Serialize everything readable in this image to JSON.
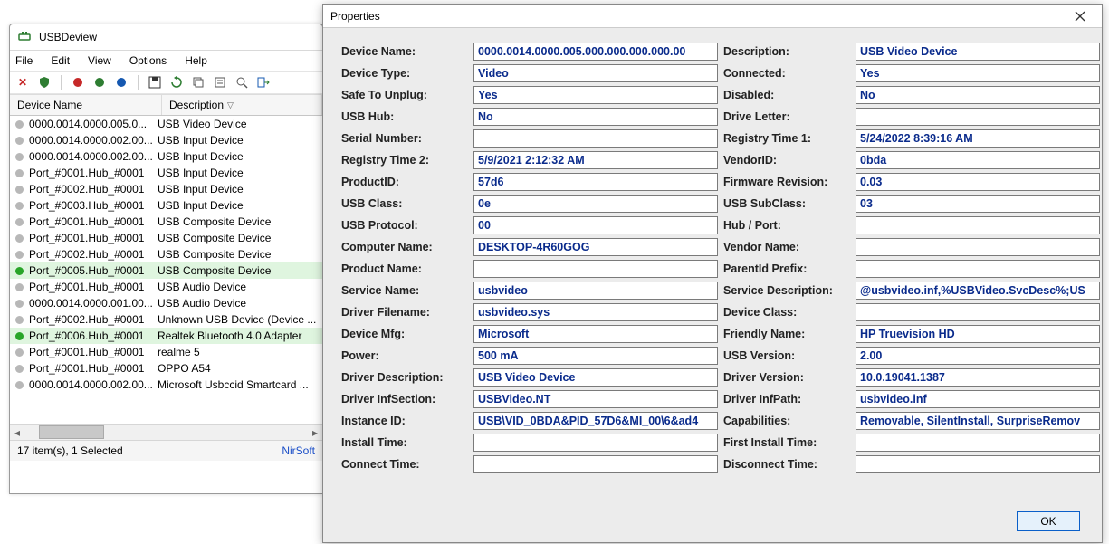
{
  "main": {
    "title": "USBDeview",
    "menu": {
      "file": "File",
      "edit": "Edit",
      "view": "View",
      "options": "Options",
      "help": "Help"
    },
    "columns": {
      "name": "Device Name",
      "desc": "Description"
    },
    "status_left": "17 item(s), 1 Selected",
    "status_right": "NirSoft",
    "rows": [
      {
        "dot": "gray",
        "name": "0000.0014.0000.005.0...",
        "desc": "USB Video Device",
        "hl": false
      },
      {
        "dot": "gray",
        "name": "0000.0014.0000.002.00...",
        "desc": "USB Input Device",
        "hl": false
      },
      {
        "dot": "gray",
        "name": "0000.0014.0000.002.00...",
        "desc": "USB Input Device",
        "hl": false
      },
      {
        "dot": "gray",
        "name": "Port_#0001.Hub_#0001",
        "desc": "USB Input Device",
        "hl": false
      },
      {
        "dot": "gray",
        "name": "Port_#0002.Hub_#0001",
        "desc": "USB Input Device",
        "hl": false
      },
      {
        "dot": "gray",
        "name": "Port_#0003.Hub_#0001",
        "desc": "USB Input Device",
        "hl": false
      },
      {
        "dot": "gray",
        "name": "Port_#0001.Hub_#0001",
        "desc": "USB Composite Device",
        "hl": false
      },
      {
        "dot": "gray",
        "name": "Port_#0001.Hub_#0001",
        "desc": "USB Composite Device",
        "hl": false
      },
      {
        "dot": "gray",
        "name": "Port_#0002.Hub_#0001",
        "desc": "USB Composite Device",
        "hl": false
      },
      {
        "dot": "green",
        "name": "Port_#0005.Hub_#0001",
        "desc": "USB Composite Device",
        "hl": true
      },
      {
        "dot": "gray",
        "name": "Port_#0001.Hub_#0001",
        "desc": "USB Audio Device",
        "hl": false
      },
      {
        "dot": "gray",
        "name": "0000.0014.0000.001.00...",
        "desc": "USB Audio Device",
        "hl": false
      },
      {
        "dot": "gray",
        "name": "Port_#0002.Hub_#0001",
        "desc": "Unknown USB Device (Device ...",
        "hl": false
      },
      {
        "dot": "green",
        "name": "Port_#0006.Hub_#0001",
        "desc": "Realtek Bluetooth 4.0 Adapter",
        "hl": true
      },
      {
        "dot": "gray",
        "name": "Port_#0001.Hub_#0001",
        "desc": "realme 5",
        "hl": false
      },
      {
        "dot": "gray",
        "name": "Port_#0001.Hub_#0001",
        "desc": "OPPO A54",
        "hl": false
      },
      {
        "dot": "gray",
        "name": "0000.0014.0000.002.00...",
        "desc": "Microsoft Usbccid Smartcard ...",
        "hl": false
      }
    ]
  },
  "dlg": {
    "title": "Properties",
    "ok": "OK",
    "fields": {
      "device_name": {
        "l": "Device Name:",
        "v": "0000.0014.0000.005.000.000.000.000.00"
      },
      "description": {
        "l": "Description:",
        "v": "USB Video Device"
      },
      "device_type": {
        "l": "Device Type:",
        "v": "Video"
      },
      "connected": {
        "l": "Connected:",
        "v": "Yes"
      },
      "safe_to_unplug": {
        "l": "Safe To Unplug:",
        "v": "Yes"
      },
      "disabled": {
        "l": "Disabled:",
        "v": "No"
      },
      "usb_hub": {
        "l": "USB Hub:",
        "v": "No"
      },
      "drive_letter": {
        "l": "Drive Letter:",
        "v": ""
      },
      "serial_number": {
        "l": "Serial Number:",
        "v": ""
      },
      "registry_time_1": {
        "l": "Registry Time 1:",
        "v": "5/24/2022 8:39:16 AM"
      },
      "registry_time_2": {
        "l": "Registry Time 2:",
        "v": "5/9/2021 2:12:32 AM"
      },
      "vendor_id": {
        "l": "VendorID:",
        "v": "0bda"
      },
      "product_id": {
        "l": "ProductID:",
        "v": "57d6"
      },
      "firmware_revision": {
        "l": "Firmware Revision:",
        "v": "0.03"
      },
      "usb_class": {
        "l": "USB Class:",
        "v": "0e"
      },
      "usb_subclass": {
        "l": "USB SubClass:",
        "v": "03"
      },
      "usb_protocol": {
        "l": "USB Protocol:",
        "v": "00"
      },
      "hub_port": {
        "l": "Hub / Port:",
        "v": ""
      },
      "computer_name": {
        "l": "Computer Name:",
        "v": "DESKTOP-4R60GOG"
      },
      "vendor_name": {
        "l": "Vendor Name:",
        "v": ""
      },
      "product_name": {
        "l": "Product Name:",
        "v": ""
      },
      "parentid_prefix": {
        "l": "ParentId Prefix:",
        "v": ""
      },
      "service_name": {
        "l": "Service Name:",
        "v": "usbvideo"
      },
      "service_description": {
        "l": "Service Description:",
        "v": "@usbvideo.inf,%USBVideo.SvcDesc%;US"
      },
      "driver_filename": {
        "l": "Driver Filename:",
        "v": "usbvideo.sys"
      },
      "device_class": {
        "l": "Device Class:",
        "v": ""
      },
      "device_mfg": {
        "l": "Device Mfg:",
        "v": "Microsoft"
      },
      "friendly_name": {
        "l": "Friendly Name:",
        "v": "HP Truevision HD"
      },
      "power": {
        "l": "Power:",
        "v": "500 mA"
      },
      "usb_version": {
        "l": "USB Version:",
        "v": "2.00"
      },
      "driver_description": {
        "l": "Driver Description:",
        "v": "USB Video Device"
      },
      "driver_version": {
        "l": "Driver Version:",
        "v": "10.0.19041.1387"
      },
      "driver_infsection": {
        "l": "Driver InfSection:",
        "v": "USBVideo.NT"
      },
      "driver_infpath": {
        "l": "Driver InfPath:",
        "v": "usbvideo.inf"
      },
      "instance_id": {
        "l": "Instance ID:",
        "v": "USB\\VID_0BDA&PID_57D6&MI_00\\6&ad4"
      },
      "capabilities": {
        "l": "Capabilities:",
        "v": "Removable, SilentInstall, SurpriseRemov"
      },
      "install_time": {
        "l": "Install Time:",
        "v": ""
      },
      "first_install_time": {
        "l": "First Install Time:",
        "v": ""
      },
      "connect_time": {
        "l": "Connect Time:",
        "v": ""
      },
      "disconnect_time": {
        "l": "Disconnect Time:",
        "v": ""
      }
    },
    "order": [
      [
        "device_name",
        "description"
      ],
      [
        "device_type",
        "connected"
      ],
      [
        "safe_to_unplug",
        "disabled"
      ],
      [
        "usb_hub",
        "drive_letter"
      ],
      [
        "serial_number",
        "registry_time_1"
      ],
      [
        "registry_time_2",
        "vendor_id"
      ],
      [
        "product_id",
        "firmware_revision"
      ],
      [
        "usb_class",
        "usb_subclass"
      ],
      [
        "usb_protocol",
        "hub_port"
      ],
      [
        "computer_name",
        "vendor_name"
      ],
      [
        "product_name",
        "parentid_prefix"
      ],
      [
        "service_name",
        "service_description"
      ],
      [
        "driver_filename",
        "device_class"
      ],
      [
        "device_mfg",
        "friendly_name"
      ],
      [
        "power",
        "usb_version"
      ],
      [
        "driver_description",
        "driver_version"
      ],
      [
        "driver_infsection",
        "driver_infpath"
      ],
      [
        "instance_id",
        "capabilities"
      ],
      [
        "install_time",
        "first_install_time"
      ],
      [
        "connect_time",
        "disconnect_time"
      ]
    ]
  }
}
